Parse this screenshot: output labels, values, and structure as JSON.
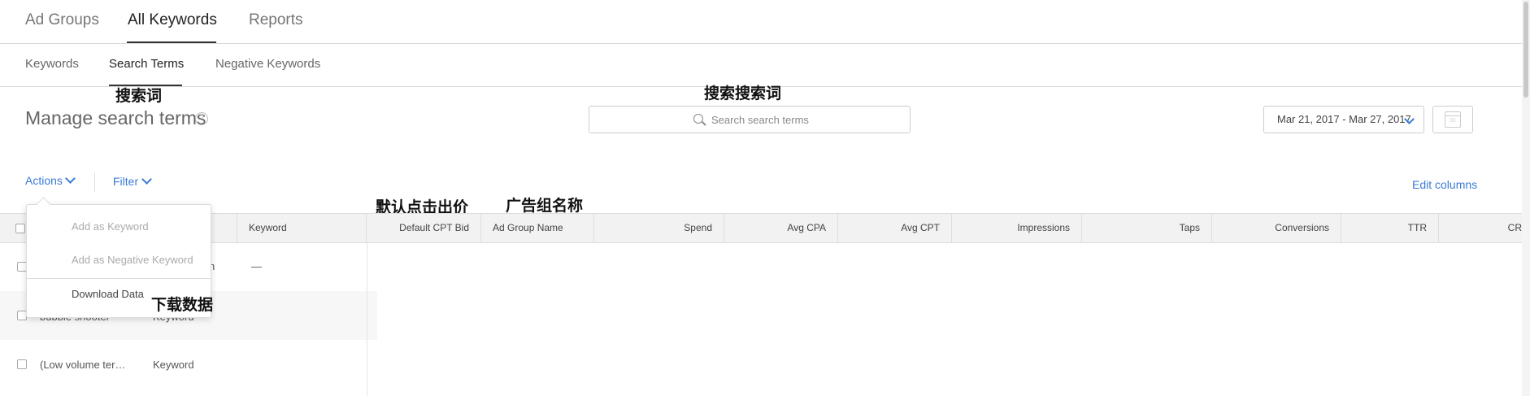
{
  "top_tabs": [
    {
      "label": "Ad Groups"
    },
    {
      "label": "All Keywords"
    },
    {
      "label": "Reports"
    }
  ],
  "sub_tabs": [
    {
      "label": "Keywords"
    },
    {
      "label": "Search Terms"
    },
    {
      "label": "Negative Keywords"
    }
  ],
  "annotations": {
    "search_terms_cn": "搜索词",
    "search_search_terms_cn": "搜索搜索词",
    "default_bid_cn": "默认点击出价",
    "ad_group_name_cn": "广告组名称",
    "download_data_cn": "下载数据"
  },
  "page": {
    "title": "Manage search terms",
    "help_glyph": "?"
  },
  "search": {
    "placeholder": "Search search terms"
  },
  "date_range": {
    "label": "Mar 21, 2017 - Mar 27, 2017",
    "calendar_glyph": "31"
  },
  "toolbar": {
    "actions_label": "Actions",
    "filter_label": "Filter",
    "edit_columns_label": "Edit columns"
  },
  "actions_menu": {
    "items": [
      {
        "label": "Add as Keyword"
      },
      {
        "label": "Add as Negative Keyword"
      },
      {
        "label": "Download Data"
      }
    ]
  },
  "table": {
    "columns": [
      {
        "label": "Keyword"
      },
      {
        "label": "Default CPT Bid"
      },
      {
        "label": "Ad Group Name"
      },
      {
        "label": "Spend"
      },
      {
        "label": "Avg CPA"
      },
      {
        "label": "Avg CPT"
      },
      {
        "label": "Impressions"
      },
      {
        "label": "Taps"
      },
      {
        "label": "Conversions"
      },
      {
        "label": "TTR"
      },
      {
        "label": "CR"
      }
    ],
    "rows": [
      {
        "search_term": "",
        "source": "h",
        "keyword": "—"
      },
      {
        "search_term": "bubble shooter",
        "source": "Keyword",
        "keyword": ""
      },
      {
        "search_term": "(Low volume ter…",
        "source": "Keyword",
        "keyword": ""
      }
    ]
  }
}
